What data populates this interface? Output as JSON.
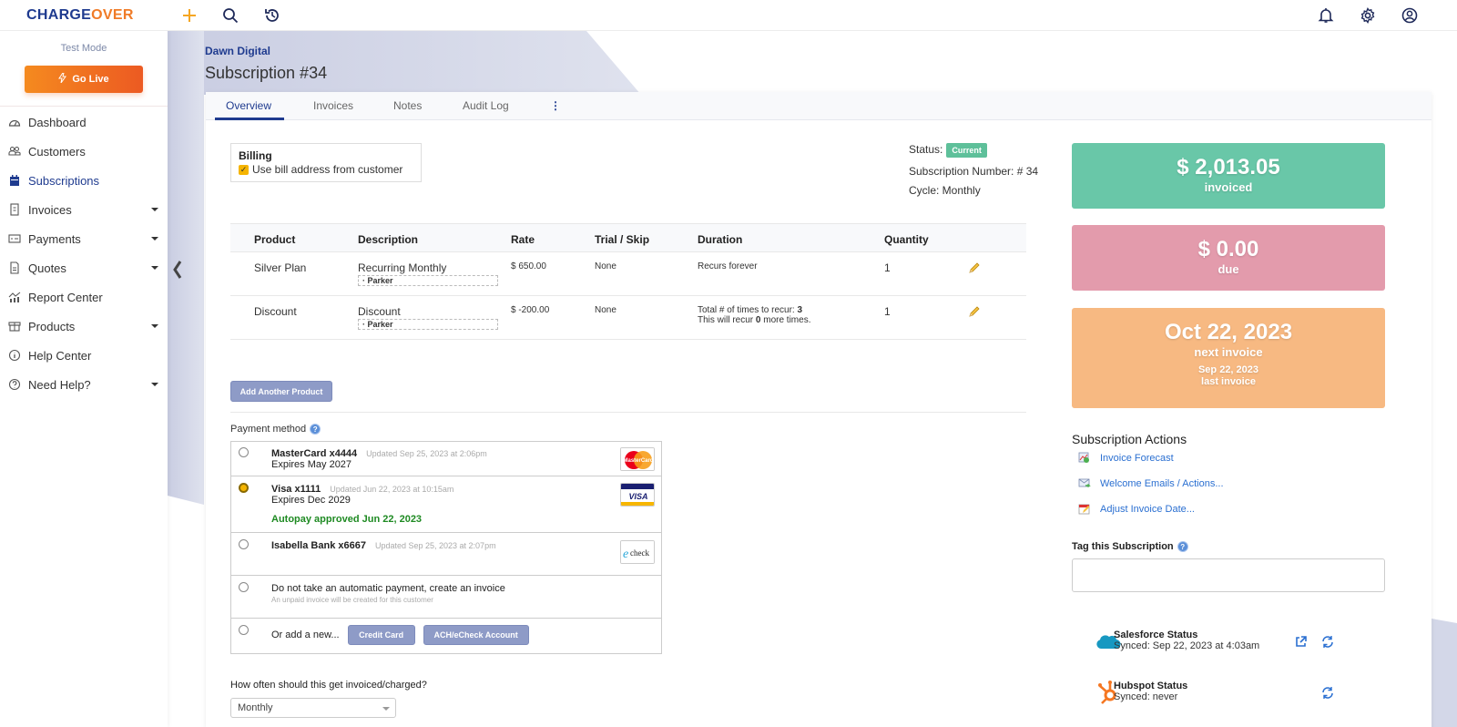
{
  "app": {
    "logo": "CHARGEOVER",
    "top_icons": [
      "plus-icon",
      "search-icon",
      "history-icon",
      "bell-icon",
      "gear-icon",
      "user-circle-icon"
    ]
  },
  "sidebar": {
    "test_mode": "Test Mode",
    "go_live": "Go Live",
    "items": [
      {
        "label": "Dashboard",
        "icon": "dashboard-icon",
        "caret": false,
        "active": false
      },
      {
        "label": "Customers",
        "icon": "customers-icon",
        "caret": false,
        "active": false
      },
      {
        "label": "Subscriptions",
        "icon": "calendar-icon",
        "caret": false,
        "active": true
      },
      {
        "label": "Invoices",
        "icon": "invoice-icon",
        "caret": true,
        "active": false
      },
      {
        "label": "Payments",
        "icon": "payments-icon",
        "caret": true,
        "active": false
      },
      {
        "label": "Quotes",
        "icon": "quote-icon",
        "caret": true,
        "active": false
      },
      {
        "label": "Report Center",
        "icon": "report-icon",
        "caret": false,
        "active": false
      },
      {
        "label": "Products",
        "icon": "products-icon",
        "caret": true,
        "active": false
      },
      {
        "label": "Help Center",
        "icon": "info-icon",
        "caret": false,
        "active": false
      },
      {
        "label": "Need Help?",
        "icon": "question-icon",
        "caret": true,
        "active": false
      }
    ]
  },
  "header": {
    "breadcrumb": "Dawn Digital",
    "title": "Subscription #34"
  },
  "tabs": [
    {
      "label": "Overview",
      "active": true
    },
    {
      "label": "Invoices",
      "active": false
    },
    {
      "label": "Notes",
      "active": false
    },
    {
      "label": "Audit Log",
      "active": false
    },
    {
      "label": "⋮",
      "active": false
    }
  ],
  "billing": {
    "title": "Billing",
    "checkbox_label": "Use bill address from customer",
    "checked": true
  },
  "status": {
    "status_label": "Status:",
    "status_value": "Current",
    "number_label": "Subscription Number: # 34",
    "cycle_label": "Cycle: Monthly"
  },
  "products": {
    "columns": [
      "Product",
      "Description",
      "Rate",
      "Trial / Skip",
      "Duration",
      "Quantity"
    ],
    "rows": [
      {
        "product": "Silver Plan",
        "description": "Recurring Monthly",
        "tag": "· Parker",
        "rate": "$ 650.00",
        "trial": "None",
        "duration_line1": "Recurs forever",
        "duration_line2": "",
        "quantity": "1"
      },
      {
        "product": "Discount",
        "description": "Discount",
        "tag": "· Parker",
        "rate": "$ -200.00",
        "trial": "None",
        "duration_line1_prefix": "Total # of times to recur: ",
        "duration_line1_bold": "3",
        "duration_line2_prefix": "This will recur ",
        "duration_line2_bold": "0",
        "duration_line2_suffix": " more times.",
        "quantity": "1"
      }
    ],
    "add_button": "Add Another Product"
  },
  "payment": {
    "label": "Payment method",
    "methods": [
      {
        "name": "MasterCard x4444",
        "updated": "Updated Sep 25, 2023 at 2:06pm",
        "expires": "Expires May 2027",
        "selected": false,
        "logo": "mastercard-logo"
      },
      {
        "name": "Visa x1111",
        "updated": "Updated Jun 22, 2023 at 10:15am",
        "expires": "Expires Dec 2029",
        "autopay": "Autopay approved Jun 22, 2023",
        "selected": true,
        "logo": "visa-logo"
      },
      {
        "name": "Isabella Bank x6667",
        "updated": "Updated Sep 25, 2023 at 2:07pm",
        "selected": false,
        "logo": "echeck-logo"
      }
    ],
    "invoice_option": "Do not take an automatic payment, create an invoice",
    "invoice_option_sub": "An unpaid invoice will be created for this customer",
    "add_new_label": "Or add a new...",
    "credit_card_button": "Credit Card",
    "ach_button": "ACH/eCheck Account",
    "logo_text": {
      "mastercard": "MasterCard",
      "visa": "VISA",
      "echeck": "check"
    }
  },
  "frequency": {
    "label": "How often should this get invoiced/charged?",
    "value": "Monthly"
  },
  "stats": {
    "invoiced_amount": "$ 2,013.05",
    "invoiced_label": "invoiced",
    "due_amount": "$ 0.00",
    "due_label": "due",
    "next_date": "Oct 22, 2023",
    "next_label": "next invoice",
    "last_date": "Sep 22, 2023",
    "last_label": "last invoice",
    "colors": {
      "invoiced": "#69c7a8",
      "due": "#e39bac",
      "next": "#f7b982"
    }
  },
  "actions": {
    "title": "Subscription Actions",
    "items": [
      {
        "label": "Invoice Forecast",
        "icon": "forecast-icon"
      },
      {
        "label": "Welcome Emails / Actions...",
        "icon": "email-icon"
      },
      {
        "label": "Adjust Invoice Date...",
        "icon": "calendar-edit-icon"
      }
    ]
  },
  "tag": {
    "label": "Tag this Subscription",
    "value": ""
  },
  "integrations": [
    {
      "title": "Salesforce Status",
      "status": "Synced: Sep 22, 2023 at 4:03am"
    },
    {
      "title": "Hubspot Status",
      "status": "Synced: never"
    }
  ]
}
